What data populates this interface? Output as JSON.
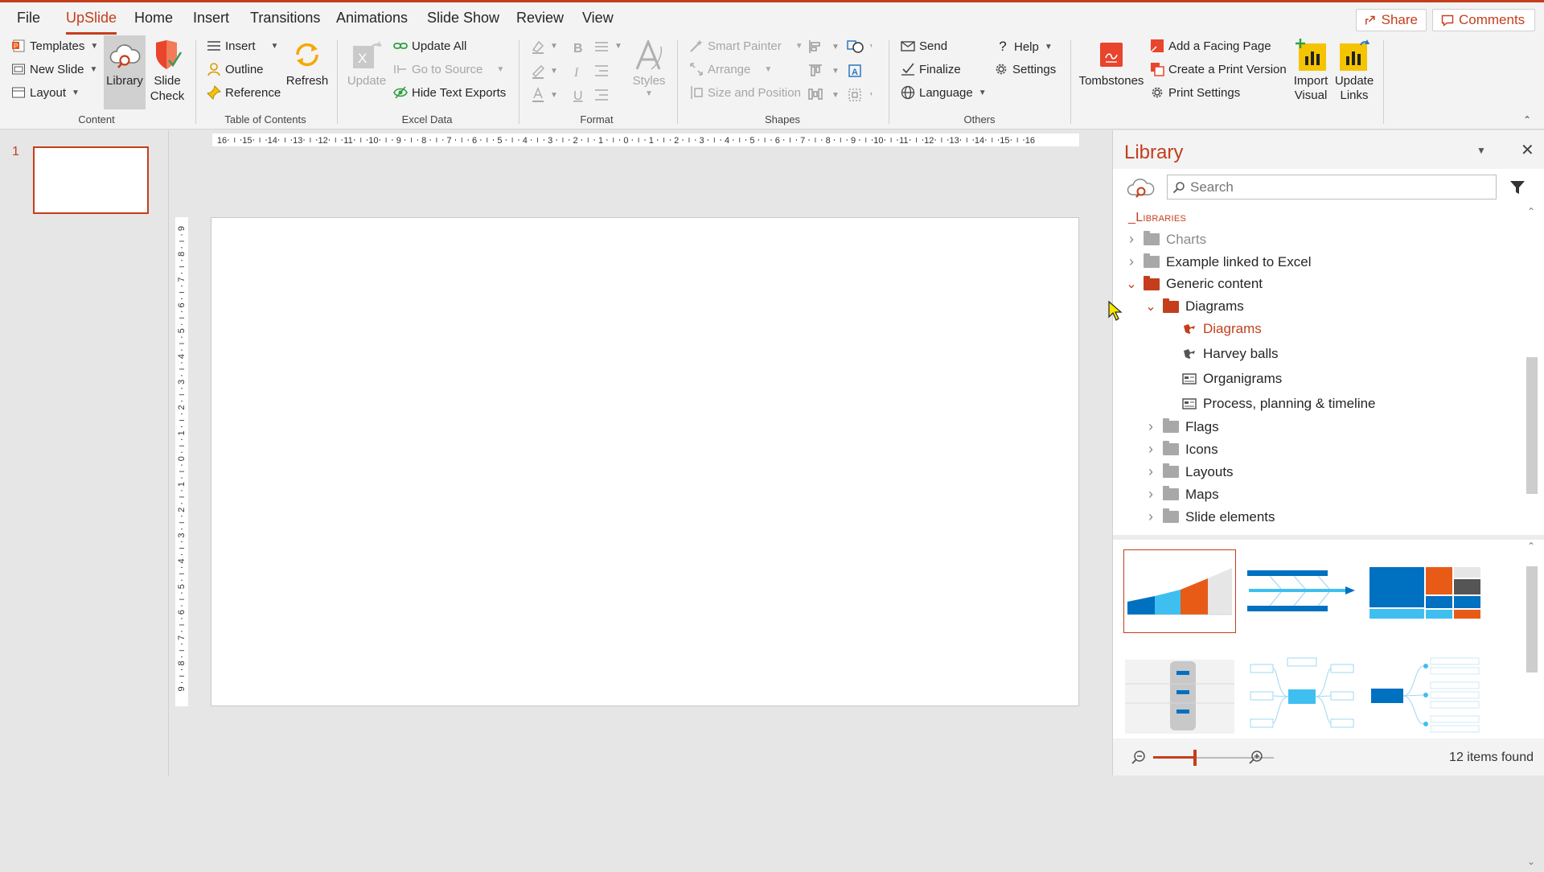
{
  "menu": {
    "items": [
      "File",
      "UpSlide",
      "Home",
      "Insert",
      "Transitions",
      "Animations",
      "Slide Show",
      "Review",
      "View"
    ],
    "active": "UpSlide",
    "share_label": "Share",
    "comments_label": "Comments"
  },
  "ribbon": {
    "content": {
      "templates": "Templates",
      "new_slide": "New Slide",
      "layout": "Layout",
      "library": "Library",
      "slide_check_1": "Slide",
      "slide_check_2": "Check",
      "group_label": "Content"
    },
    "toc": {
      "insert": "Insert",
      "outline": "Outline",
      "reference": "Reference",
      "refresh": "Refresh",
      "group_label": "Table of Contents"
    },
    "excel": {
      "update": "Update",
      "update_all": "Update All",
      "go_to_source": "Go to Source",
      "hide_text_exports": "Hide Text Exports",
      "group_label": "Excel Data"
    },
    "format": {
      "styles": "Styles",
      "group_label": "Format"
    },
    "shapes": {
      "smart_painter": "Smart Painter",
      "arrange": "Arrange",
      "size_position": "Size and Position",
      "group_label": "Shapes"
    },
    "others": {
      "send": "Send",
      "finalize": "Finalize",
      "language": "Language",
      "help": "Help",
      "settings": "Settings",
      "group_label": "Others"
    },
    "extra": {
      "tombstones": "Tombstones",
      "add_facing_page": "Add a Facing Page",
      "create_print_version": "Create a Print Version",
      "print_settings": "Print Settings",
      "import_visual_1": "Import",
      "import_visual_2": "Visual",
      "update_links_1": "Update",
      "update_links_2": "Links"
    }
  },
  "thumbnails": {
    "slide_number": "1"
  },
  "ruler": {
    "h_ticks": [
      "16",
      "15",
      "14",
      "13",
      "12",
      "11",
      "10",
      "9",
      "8",
      "7",
      "6",
      "5",
      "4",
      "3",
      "2",
      "1",
      "0",
      "1",
      "2",
      "3",
      "4",
      "5",
      "6",
      "7",
      "8",
      "9",
      "10",
      "11",
      "12",
      "13",
      "14",
      "15",
      "16"
    ],
    "v_ticks": [
      "9",
      "8",
      "7",
      "6",
      "5",
      "4",
      "3",
      "2",
      "1",
      "0",
      "1",
      "2",
      "3",
      "4",
      "5",
      "6",
      "7",
      "8",
      "9"
    ]
  },
  "library": {
    "title": "Library",
    "search_placeholder": "Search",
    "section": "_Libraries",
    "tree": [
      {
        "label": "Charts",
        "level": 0,
        "type": "folder",
        "state": "collapsed",
        "dim": true
      },
      {
        "label": "Example linked to Excel",
        "level": 0,
        "type": "folder",
        "state": "collapsed"
      },
      {
        "label": "Generic content",
        "level": 0,
        "type": "folder",
        "state": "expanded"
      },
      {
        "label": "Diagrams",
        "level": 1,
        "type": "folder",
        "state": "expanded"
      },
      {
        "label": "Diagrams",
        "level": 2,
        "type": "item",
        "selected": true
      },
      {
        "label": "Harvey balls",
        "level": 2,
        "type": "item"
      },
      {
        "label": "Organigrams",
        "level": 2,
        "type": "item"
      },
      {
        "label": "Process, planning & timeline",
        "level": 2,
        "type": "item"
      },
      {
        "label": "Flags",
        "level": 1,
        "type": "folder",
        "state": "collapsed"
      },
      {
        "label": "Icons",
        "level": 1,
        "type": "folder",
        "state": "collapsed"
      },
      {
        "label": "Layouts",
        "level": 1,
        "type": "folder",
        "state": "collapsed"
      },
      {
        "label": "Maps",
        "level": 1,
        "type": "folder",
        "state": "collapsed"
      },
      {
        "label": "Slide elements",
        "level": 1,
        "type": "folder",
        "state": "collapsed"
      }
    ],
    "items_found": "12 items found"
  },
  "colors": {
    "accent": "#c43e1c",
    "blue": "#0070c0",
    "light_blue": "#3fbff0",
    "orange": "#e85b17",
    "yellow": "#f5c400"
  }
}
